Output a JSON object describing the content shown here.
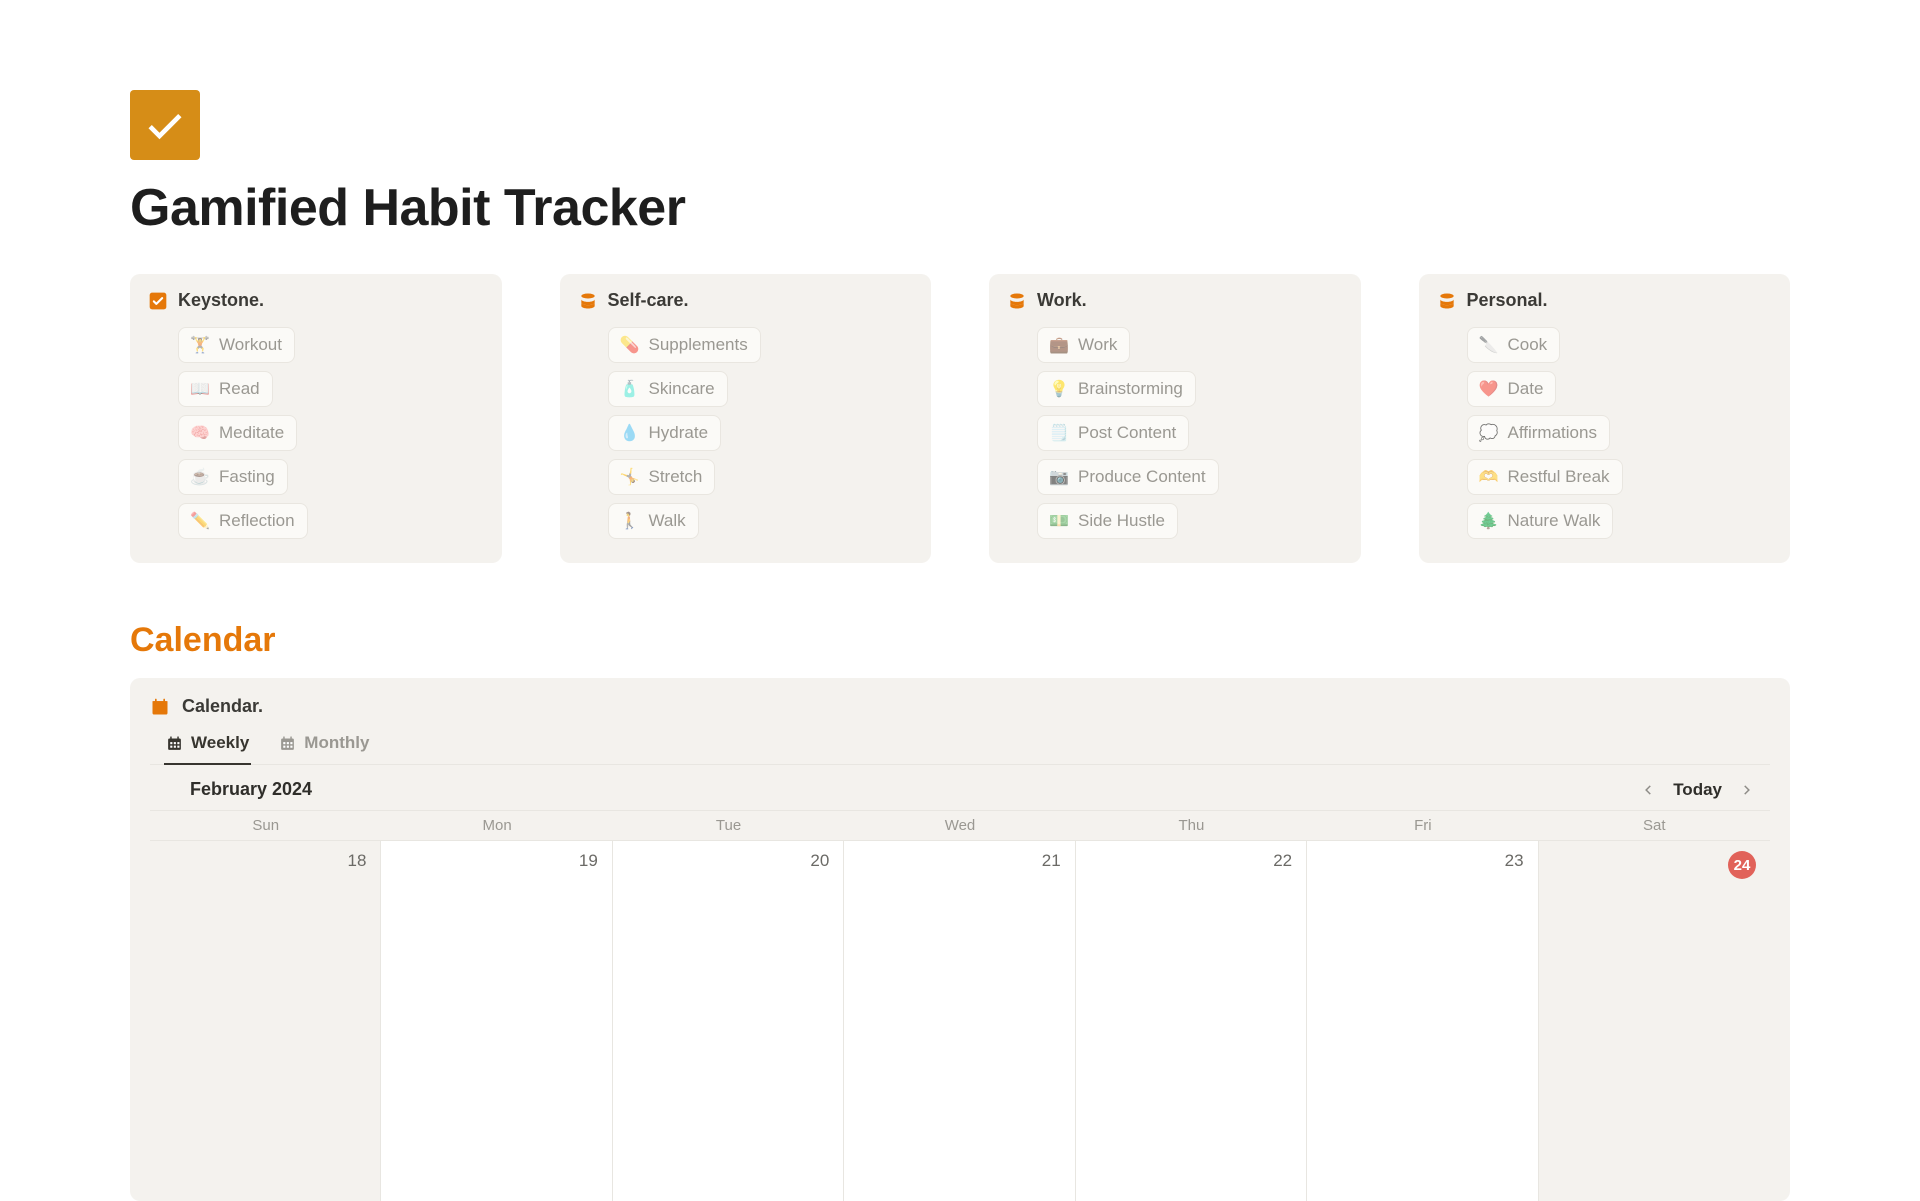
{
  "page": {
    "title": "Gamified Habit Tracker"
  },
  "groups": [
    {
      "title": "Keystone.",
      "icon": "checkbox",
      "items": [
        {
          "icon": "dumbbell",
          "label": "Workout"
        },
        {
          "icon": "book",
          "label": "Read"
        },
        {
          "icon": "brain",
          "label": "Meditate"
        },
        {
          "icon": "cup",
          "label": "Fasting"
        },
        {
          "icon": "pencil",
          "label": "Reflection"
        }
      ]
    },
    {
      "title": "Self-care.",
      "icon": "stack",
      "items": [
        {
          "icon": "pill",
          "label": "Supplements"
        },
        {
          "icon": "lotion",
          "label": "Skincare"
        },
        {
          "icon": "drop",
          "label": "Hydrate"
        },
        {
          "icon": "person",
          "label": "Stretch"
        },
        {
          "icon": "walk",
          "label": "Walk"
        }
      ]
    },
    {
      "title": "Work.",
      "icon": "stack",
      "items": [
        {
          "icon": "briefcase",
          "label": "Work"
        },
        {
          "icon": "bulb",
          "label": "Brainstorming"
        },
        {
          "icon": "post",
          "label": "Post Content"
        },
        {
          "icon": "camera",
          "label": "Produce Content"
        },
        {
          "icon": "cash",
          "label": "Side Hustle"
        }
      ]
    },
    {
      "title": "Personal.",
      "icon": "stack",
      "items": [
        {
          "icon": "knife",
          "label": "Cook"
        },
        {
          "icon": "heart",
          "label": "Date"
        },
        {
          "icon": "cloud",
          "label": "Affirmations"
        },
        {
          "icon": "rest",
          "label": "Restful Break"
        },
        {
          "icon": "tree",
          "label": "Nature Walk"
        }
      ]
    }
  ],
  "section_calendar_title": "Calendar",
  "calendar": {
    "panel_title": "Calendar.",
    "tabs": [
      {
        "label": "Weekly",
        "active": true
      },
      {
        "label": "Monthly",
        "active": false
      }
    ],
    "month_label": "February 2024",
    "today_label": "Today",
    "dow": [
      "Sun",
      "Mon",
      "Tue",
      "Wed",
      "Thu",
      "Fri",
      "Sat"
    ],
    "days": [
      {
        "num": "18",
        "shade": true,
        "today": false
      },
      {
        "num": "19",
        "shade": false,
        "today": false
      },
      {
        "num": "20",
        "shade": false,
        "today": false
      },
      {
        "num": "21",
        "shade": false,
        "today": false
      },
      {
        "num": "22",
        "shade": false,
        "today": false
      },
      {
        "num": "23",
        "shade": false,
        "today": false
      },
      {
        "num": "24",
        "shade": true,
        "today": true
      }
    ]
  }
}
